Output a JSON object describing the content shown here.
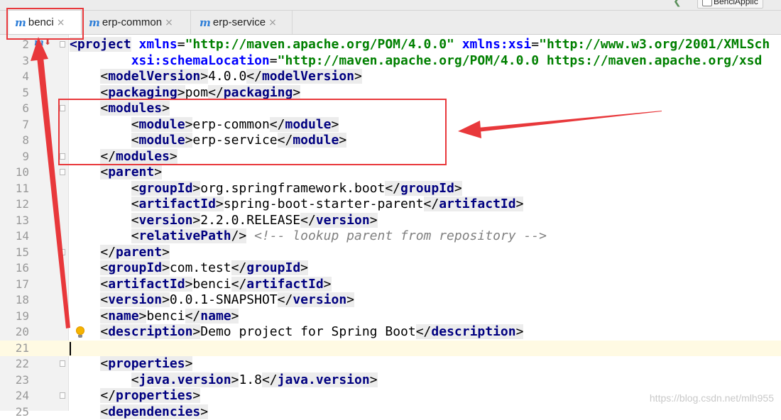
{
  "toolbar": {
    "run_config_label": "BenciApplic"
  },
  "tabs": [
    {
      "label": "benci",
      "icon": "m",
      "active": true
    },
    {
      "label": "erp-common",
      "icon": "m",
      "active": false
    },
    {
      "label": "erp-service",
      "icon": "m",
      "active": false
    }
  ],
  "tab_close_glyph": "×",
  "gutter_lines": [
    "2",
    "3",
    "4",
    "5",
    "6",
    "7",
    "8",
    "9",
    "10",
    "11",
    "12",
    "13",
    "14",
    "15",
    "16",
    "17",
    "18",
    "19",
    "20",
    "21",
    "22",
    "23",
    "24",
    "25"
  ],
  "code": {
    "l2": {
      "open": "<",
      "tag": "project",
      "a1": "xmlns",
      "eq1": "=",
      "v1": "\"http://maven.apache.org/POM/4.0.0\"",
      "a2": "xmlns:xsi",
      "eq2": "=",
      "v2": "\"http://www.w3.org/2001/XMLSch"
    },
    "l3": {
      "a": "xsi:schemaLocation",
      "eq": "=",
      "v": "\"http://maven.apache.org/POM/4.0.0 https://maven.apache.org/xsd"
    },
    "l4": {
      "tag": "modelVersion",
      "value": "4.0.0"
    },
    "l5": {
      "tag": "packaging",
      "value": "pom"
    },
    "l6": {
      "tag": "modules"
    },
    "l7": {
      "tag": "module",
      "value": "erp-common"
    },
    "l8": {
      "tag": "module",
      "value": "erp-service"
    },
    "l9": {
      "tag": "modules"
    },
    "l10": {
      "tag": "parent"
    },
    "l11": {
      "tag": "groupId",
      "value": "org.springframework.boot"
    },
    "l12": {
      "tag": "artifactId",
      "value": "spring-boot-starter-parent"
    },
    "l13": {
      "tag": "version",
      "value": "2.2.0.RELEASE"
    },
    "l14": {
      "tag": "relativePath",
      "comment": "<!-- lookup parent from repository -->"
    },
    "l15": {
      "tag": "parent"
    },
    "l16": {
      "tag": "groupId",
      "value": "com.test"
    },
    "l17": {
      "tag": "artifactId",
      "value": "benci"
    },
    "l18": {
      "tag": "version",
      "value": "0.0.1-SNAPSHOT"
    },
    "l19": {
      "tag": "name",
      "value": "benci"
    },
    "l20": {
      "tag": "description",
      "value": "Demo project for Spring Boot"
    },
    "l22": {
      "tag": "properties"
    },
    "l23": {
      "tag": "java.version",
      "value": "1.8"
    },
    "l24": {
      "tag": "properties"
    },
    "l25": {
      "tag": "dependencies"
    }
  },
  "icons": {
    "maven_file": "maven-m-icon",
    "intention_bulb": "lightbulb-icon",
    "fold_marker": "fold-marker-icon",
    "gutter_overrides": "maven-gutter-icon"
  },
  "colors": {
    "tag": "#000080",
    "attribute": "#0000ff",
    "string": "#008000",
    "comment": "#808080",
    "annotation": "#e8383b",
    "maven_icon": "#2f7fd8",
    "current_line": "#fffae3"
  },
  "watermark": "https://blog.csdn.net/mlh955"
}
